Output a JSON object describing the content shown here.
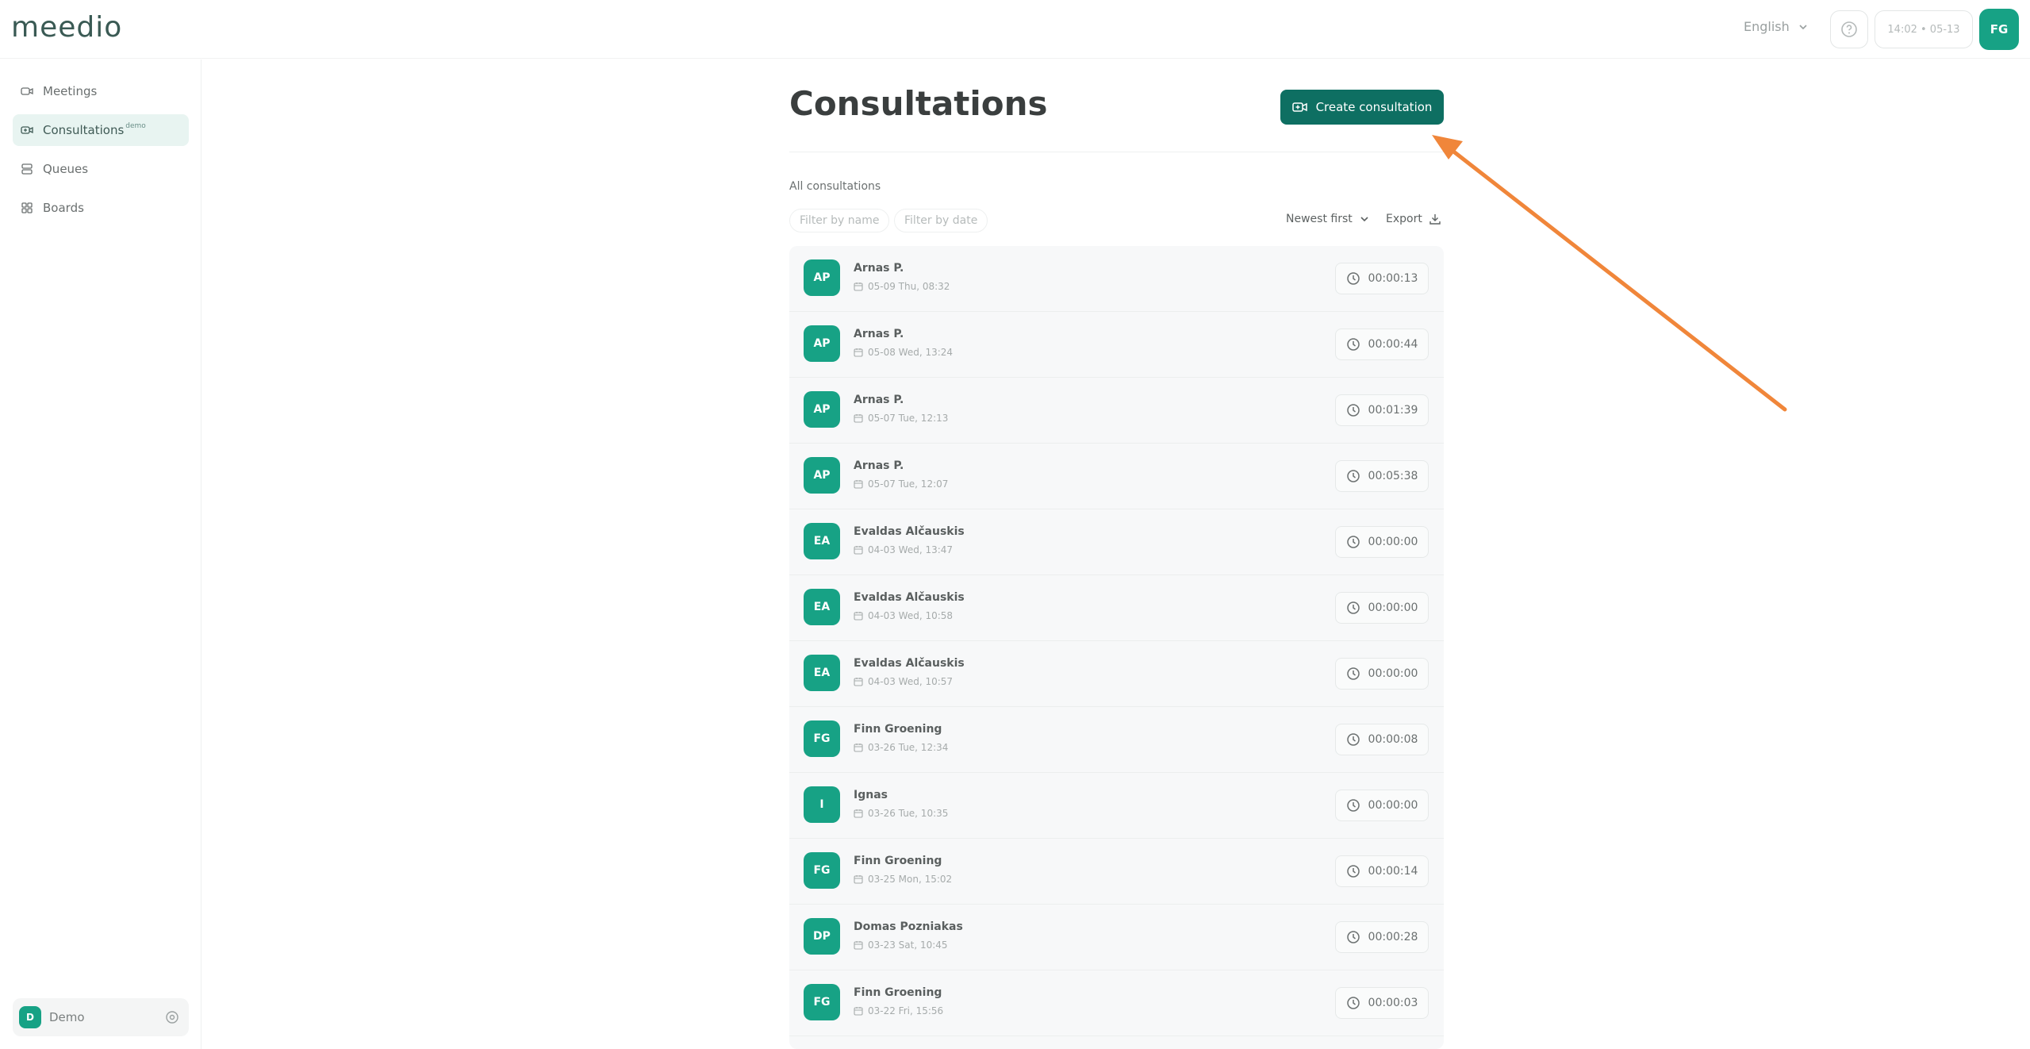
{
  "app": {
    "logo": "meedio",
    "language": "English",
    "clock": "14:02 • 05-13",
    "user_initials": "FG"
  },
  "sidebar": {
    "items": [
      {
        "label": "Meetings",
        "icon": "video-icon"
      },
      {
        "label": "Consultations",
        "badge": "demo",
        "icon": "video-plus-icon"
      },
      {
        "label": "Queues",
        "icon": "queue-icon"
      },
      {
        "label": "Boards",
        "icon": "grid-icon"
      }
    ],
    "org": {
      "initial": "D",
      "name": "Demo"
    }
  },
  "main": {
    "title": "Consultations",
    "create_label": "Create consultation",
    "section_label": "All consultations",
    "filter_name_placeholder": "Filter by name",
    "filter_date_placeholder": "Filter by date",
    "sort_label": "Newest first",
    "export_label": "Export",
    "rows": [
      {
        "initials": "AP",
        "name": "Arnas P.",
        "date": "05-09 Thu, 08:32",
        "duration": "00:00:13"
      },
      {
        "initials": "AP",
        "name": "Arnas P.",
        "date": "05-08 Wed, 13:24",
        "duration": "00:00:44"
      },
      {
        "initials": "AP",
        "name": "Arnas P.",
        "date": "05-07 Tue, 12:13",
        "duration": "00:01:39"
      },
      {
        "initials": "AP",
        "name": "Arnas P.",
        "date": "05-07 Tue, 12:07",
        "duration": "00:05:38"
      },
      {
        "initials": "EA",
        "name": "Evaldas Alčauskis",
        "date": "04-03 Wed, 13:47",
        "duration": "00:00:00"
      },
      {
        "initials": "EA",
        "name": "Evaldas Alčauskis",
        "date": "04-03 Wed, 10:58",
        "duration": "00:00:00"
      },
      {
        "initials": "EA",
        "name": "Evaldas Alčauskis",
        "date": "04-03 Wed, 10:57",
        "duration": "00:00:00"
      },
      {
        "initials": "FG",
        "name": "Finn Groening",
        "date": "03-26 Tue, 12:34",
        "duration": "00:00:08"
      },
      {
        "initials": "I",
        "name": "Ignas",
        "date": "03-26 Tue, 10:35",
        "duration": "00:00:00"
      },
      {
        "initials": "FG",
        "name": "Finn Groening",
        "date": "03-25 Mon, 15:02",
        "duration": "00:00:14"
      },
      {
        "initials": "DP",
        "name": "Domas Pozniakas",
        "date": "03-23 Sat, 10:45",
        "duration": "00:00:28"
      },
      {
        "initials": "FG",
        "name": "Finn Groening",
        "date": "03-22 Fri, 15:56",
        "duration": "00:00:03"
      }
    ]
  },
  "colors": {
    "accent": "#17a285",
    "button": "#0e6f62",
    "annotation_arrow": "#f0863a"
  }
}
